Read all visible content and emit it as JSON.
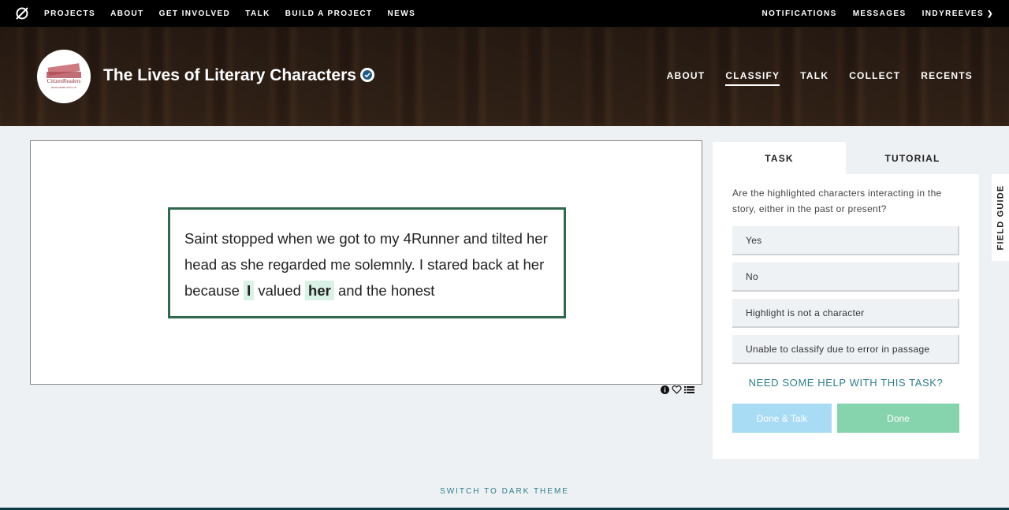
{
  "topnav": {
    "logo_icon": "zooniverse-logo-icon",
    "links": [
      "PROJECTS",
      "ABOUT",
      "GET INVOLVED",
      "TALK",
      "BUILD A PROJECT",
      "NEWS"
    ],
    "right": {
      "notifications": "NOTIFICATIONS",
      "messages": "MESSAGES",
      "user": "INDYREEVES",
      "user_chevron": "chevron-down-icon"
    }
  },
  "project": {
    "title": "The Lives of Literary Characters",
    "avatar_text": "CitizenReaders",
    "verified_icon": "check-badge-icon",
    "nav": [
      "ABOUT",
      "CLASSIFY",
      "TALK",
      "COLLECT",
      "RECENTS"
    ],
    "active_nav": "CLASSIFY"
  },
  "subject": {
    "before": "Saint stopped when we got to my 4Runner and tilted her head as she regarded me solemnly. I stared back at her because",
    "highlight1": "I",
    "middle": "valued",
    "highlight2": "her",
    "after": "and the honest",
    "tools": [
      "info-icon",
      "heart-icon",
      "list-icon"
    ]
  },
  "task": {
    "tabs": [
      "TASK",
      "TUTORIAL"
    ],
    "question": "Are the highlighted characters interacting in the story, either in the past or present?",
    "answers": [
      "Yes",
      "No",
      "Highlight is not a character",
      "Unable to classify due to error in passage"
    ],
    "help": "NEED SOME HELP WITH THIS TASK?",
    "done_talk": "Done & Talk",
    "done": "Done"
  },
  "field_guide": "FIELD GUIDE",
  "footer": {
    "switch_theme": "SWITCH TO DARK THEME"
  },
  "colors": {
    "accent": "#2f6a4f",
    "highlight": "#d9f2e5",
    "link": "#2e7f8c",
    "done_talk_bg": "#a8dcf4",
    "done_bg": "#86d4ad"
  }
}
